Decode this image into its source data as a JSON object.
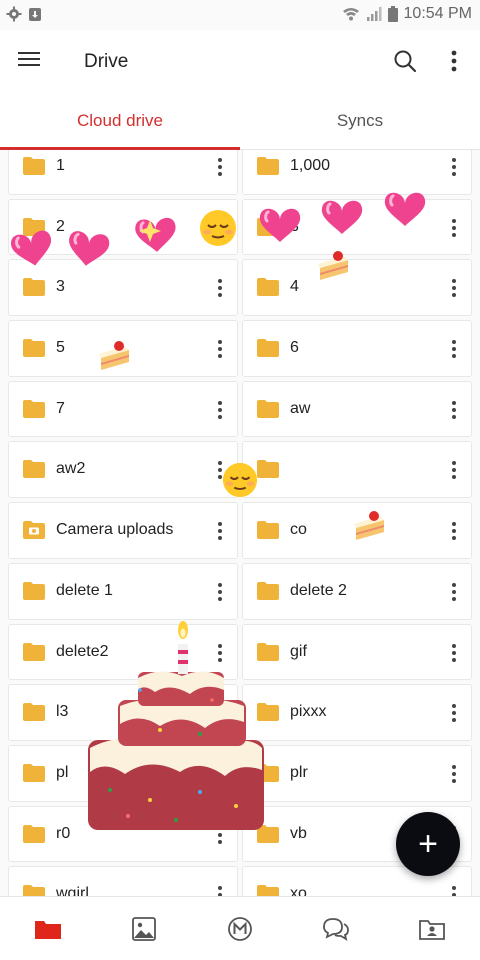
{
  "status_bar": {
    "time": "10:54 PM"
  },
  "app_bar": {
    "title": "Drive"
  },
  "tabs": [
    {
      "label": "Cloud drive",
      "active": true
    },
    {
      "label": "Syncs",
      "active": false
    }
  ],
  "accent_color": "#d32f2f",
  "folder_color": "#f0b33a",
  "folders": [
    {
      "name": "1"
    },
    {
      "name": "1,000"
    },
    {
      "name": "2"
    },
    {
      "name": "3"
    },
    {
      "name": "3"
    },
    {
      "name": "4"
    },
    {
      "name": "5"
    },
    {
      "name": "6"
    },
    {
      "name": "7"
    },
    {
      "name": "aw"
    },
    {
      "name": "aw2"
    },
    {
      "name": ""
    },
    {
      "name": "Camera uploads",
      "icon": "camera-folder-icon"
    },
    {
      "name": "co"
    },
    {
      "name": "delete 1"
    },
    {
      "name": "delete 2"
    },
    {
      "name": "delete2"
    },
    {
      "name": "gif"
    },
    {
      "name": "l3"
    },
    {
      "name": "pixxx"
    },
    {
      "name": "pl"
    },
    {
      "name": "plr"
    },
    {
      "name": "r0"
    },
    {
      "name": "vb"
    },
    {
      "name": "wgirl"
    },
    {
      "name": "xo"
    }
  ],
  "fab": {
    "label": "+"
  },
  "bottom_nav": [
    {
      "icon": "cloud-drive-icon",
      "active": true
    },
    {
      "icon": "photos-icon",
      "active": false
    },
    {
      "icon": "mega-home-icon",
      "active": false
    },
    {
      "icon": "chat-icon",
      "active": false
    },
    {
      "icon": "shared-items-icon",
      "active": false
    }
  ]
}
